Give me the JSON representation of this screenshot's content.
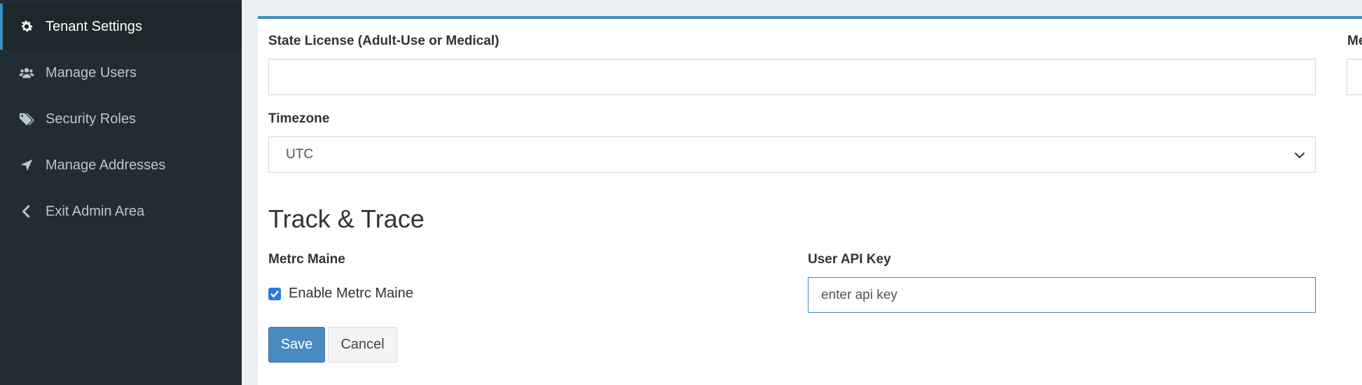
{
  "sidebar": {
    "items": [
      {
        "label": "Tenant Settings",
        "icon": "gear-icon",
        "active": true
      },
      {
        "label": "Manage Users",
        "icon": "users-icon",
        "active": false
      },
      {
        "label": "Security Roles",
        "icon": "tags-icon",
        "active": false
      },
      {
        "label": "Manage Addresses",
        "icon": "location-arrow-icon",
        "active": false
      },
      {
        "label": "Exit Admin Area",
        "icon": "chevron-left-icon",
        "active": false
      }
    ]
  },
  "form": {
    "state_license": {
      "label": "State License (Adult-Use or Medical)",
      "value": ""
    },
    "right_cut_label": "Me",
    "timezone": {
      "label": "Timezone",
      "value": "UTC"
    },
    "track_trace": {
      "heading": "Track & Trace",
      "metrc": {
        "label": "Metrc Maine",
        "checkbox_label": "Enable Metrc Maine",
        "checked": true
      },
      "api_key": {
        "label": "User API Key",
        "value": "enter api key"
      }
    },
    "buttons": {
      "save": "Save",
      "cancel": "Cancel"
    }
  },
  "colors": {
    "accent": "#3c8dbc",
    "sidebar_bg": "#222d32",
    "primary_button": "#4a8ac0"
  }
}
